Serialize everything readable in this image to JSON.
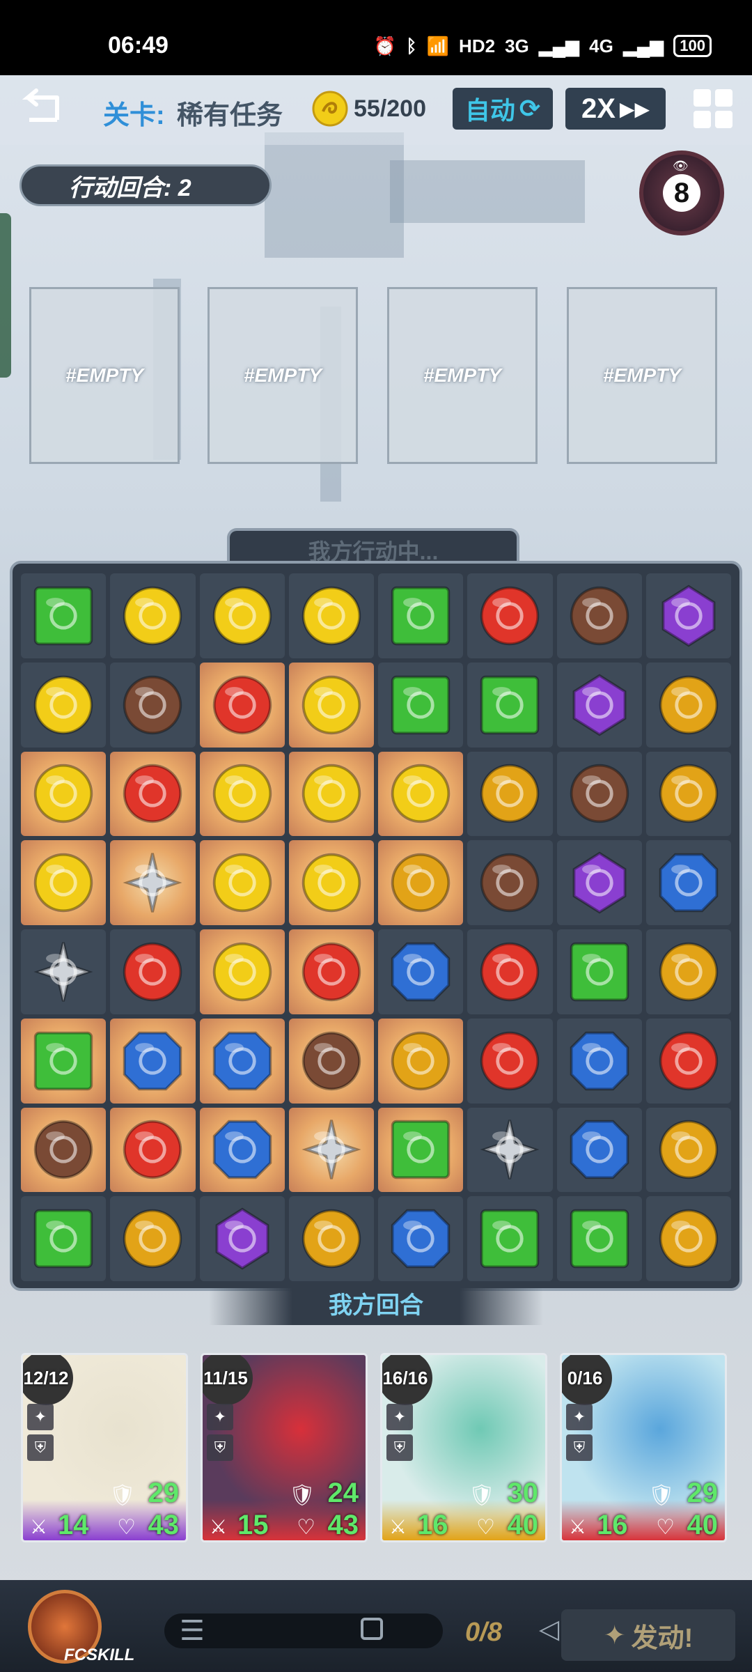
{
  "status_bar": {
    "time": "06:49",
    "network_a": "3G",
    "network_b": "4G",
    "hd": "HD2",
    "battery": "100"
  },
  "top_bar": {
    "stage_label": "关卡:",
    "stage_name": "稀有任务",
    "coins": "55/200",
    "auto_label": "自动",
    "speed_label": "2X"
  },
  "turn_info": {
    "action_turn": "行动回合: 2",
    "counter": "8"
  },
  "slots": [
    "#EMPTY",
    "#EMPTY",
    "#EMPTY",
    "#EMPTY"
  ],
  "board": {
    "status": "我方行动中...",
    "turn_banner": "我方回合",
    "gem_types": {
      "G": {
        "name": "green-gem",
        "color": "#3fbe3a"
      },
      "Y": {
        "name": "yellow-gem",
        "color": "#f2cd18"
      },
      "R": {
        "name": "red-gem",
        "color": "#e0352a"
      },
      "B": {
        "name": "brown-gem",
        "color": "#7a4a35"
      },
      "P": {
        "name": "purple-gem",
        "color": "#8a3fd0"
      },
      "O": {
        "name": "orange-gem",
        "color": "#e2a317"
      },
      "U": {
        "name": "blue-gem",
        "color": "#2f6fd4"
      },
      "S": {
        "name": "silver-gem",
        "color": "#cfd4da"
      }
    },
    "rows": [
      [
        "G",
        "Y",
        "Y",
        "Y",
        "G",
        "R",
        "B",
        "P"
      ],
      [
        "Y",
        "B",
        "R",
        "Y",
        "G",
        "G",
        "P",
        "O"
      ],
      [
        "Y",
        "R",
        "Y",
        "Y",
        "Y",
        "O",
        "B",
        "O"
      ],
      [
        "Y",
        "S",
        "Y",
        "Y",
        "O",
        "B",
        "P",
        "U"
      ],
      [
        "S",
        "R",
        "Y",
        "R",
        "U",
        "R",
        "G",
        "O"
      ],
      [
        "G",
        "U",
        "U",
        "B",
        "O",
        "R",
        "U",
        "R"
      ],
      [
        "B",
        "R",
        "U",
        "S",
        "G",
        "S",
        "U",
        "O"
      ],
      [
        "G",
        "O",
        "P",
        "O",
        "U",
        "G",
        "G",
        "O"
      ]
    ],
    "highlight": [
      [
        1,
        2
      ],
      [
        1,
        3
      ],
      [
        2,
        0
      ],
      [
        2,
        1
      ],
      [
        2,
        2
      ],
      [
        2,
        3
      ],
      [
        2,
        4
      ],
      [
        3,
        0
      ],
      [
        3,
        1
      ],
      [
        3,
        2
      ],
      [
        3,
        3
      ],
      [
        3,
        4
      ],
      [
        4,
        2
      ],
      [
        4,
        3
      ],
      [
        5,
        0
      ],
      [
        5,
        1
      ],
      [
        5,
        2
      ],
      [
        5,
        3
      ],
      [
        5,
        4
      ],
      [
        6,
        0
      ],
      [
        6,
        1
      ],
      [
        6,
        2
      ],
      [
        6,
        3
      ],
      [
        6,
        4
      ]
    ]
  },
  "characters": [
    {
      "hp_ratio": "12/12",
      "def": "29",
      "atk": "14",
      "hp": "43",
      "bar_color": "#8a3fd0",
      "art_bg": "#efe9d8",
      "hair": "#e8e2cf"
    },
    {
      "hp_ratio": "11/15",
      "def": "24",
      "atk": "15",
      "hp": "43",
      "bar_color": "#d8333a",
      "art_bg": "#5a3b5c",
      "hair": "#d8303a"
    },
    {
      "hp_ratio": "16/16",
      "def": "30",
      "atk": "16",
      "hp": "40",
      "bar_color": "#e2a317",
      "art_bg": "#d9ecea",
      "hair": "#6fc9b4"
    },
    {
      "hp_ratio": "0/16",
      "def": "29",
      "atk": "16",
      "hp": "40",
      "bar_color": "#d8333a",
      "art_bg": "#bfe3ef",
      "hair": "#5aa6dc"
    }
  ],
  "bottom_bar": {
    "logo_text": "FCSKILL",
    "gem_count": "0/8",
    "launch_label": "发动!"
  }
}
